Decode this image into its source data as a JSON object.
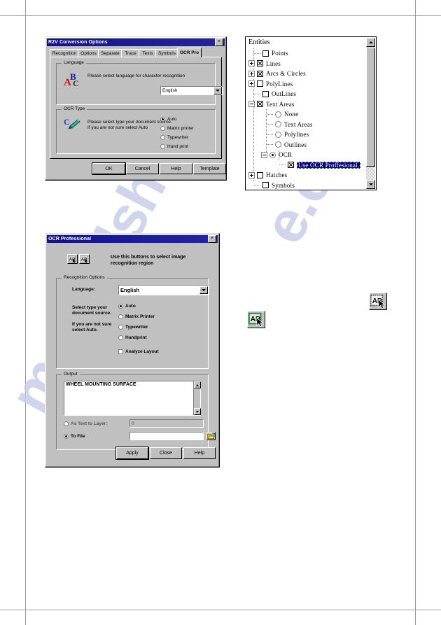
{
  "watermark": {
    "left": "manualshiv",
    "right": "e.com"
  },
  "r2v_dialog": {
    "title": "R2V Conversion Options",
    "close_label": "×",
    "tabs": [
      {
        "label": "Recognition",
        "active": false
      },
      {
        "label": "Options",
        "active": false
      },
      {
        "label": "Separate",
        "active": false
      },
      {
        "label": "Trace",
        "active": false
      },
      {
        "label": "Texts",
        "active": false
      },
      {
        "label": "Symbols",
        "active": false
      },
      {
        "label": "OCR Pro",
        "active": true
      }
    ],
    "language_group": {
      "legend": "Language",
      "icon": "abc-letters-icon",
      "description": "Please select language for character recognition",
      "combo_value": "English"
    },
    "ocr_type_group": {
      "legend": "OCR Type",
      "icon": "pen-writing-icon",
      "description_line1": "Please select type your document source.",
      "description_line2": "If you are not sure select Auto",
      "options": [
        {
          "label": "Auto",
          "mnemonic": "A",
          "selected": true
        },
        {
          "label": "Matrix printer",
          "mnemonic": "M",
          "selected": false
        },
        {
          "label": "Typewriter",
          "mnemonic": "T",
          "selected": false
        },
        {
          "label": "Hand print",
          "mnemonic": "H",
          "selected": false
        }
      ]
    },
    "buttons": [
      {
        "label": "OK",
        "default": true
      },
      {
        "label": "Cancel",
        "default": false
      },
      {
        "label": "Help",
        "default": false
      },
      {
        "label": "Template",
        "default": false
      }
    ]
  },
  "entities_tree": {
    "root_label": "Entities",
    "nodes": [
      {
        "label": "Points",
        "control": "checkbox",
        "checked": false,
        "expander": "none",
        "depth": 1,
        "selected": false
      },
      {
        "label": "Lines",
        "control": "checkbox",
        "checked": true,
        "expander": "plus",
        "depth": 1,
        "selected": false
      },
      {
        "label": "Arcs & Circles",
        "control": "checkbox",
        "checked": true,
        "expander": "plus",
        "depth": 1,
        "selected": false
      },
      {
        "label": "PolyLines",
        "control": "checkbox",
        "checked": false,
        "expander": "plus",
        "depth": 1,
        "selected": false
      },
      {
        "label": "OutLines",
        "control": "checkbox",
        "checked": false,
        "expander": "none",
        "depth": 1,
        "selected": false
      },
      {
        "label": "Text Areas",
        "control": "checkbox",
        "checked": true,
        "expander": "minus",
        "depth": 1,
        "selected": false
      },
      {
        "label": "None",
        "control": "radio",
        "checked": false,
        "expander": "none",
        "depth": 2,
        "selected": false
      },
      {
        "label": "Text Areas",
        "control": "radio",
        "checked": false,
        "expander": "none",
        "depth": 2,
        "selected": false
      },
      {
        "label": "Polylines",
        "control": "radio",
        "checked": false,
        "expander": "none",
        "depth": 2,
        "selected": false
      },
      {
        "label": "Outlines",
        "control": "radio",
        "checked": false,
        "expander": "none",
        "depth": 2,
        "selected": false
      },
      {
        "label": "OCR",
        "control": "radio",
        "checked": true,
        "expander": "minus",
        "depth": 2,
        "selected": false
      },
      {
        "label": "Use OCR Proffesional.",
        "control": "checkbox",
        "checked": true,
        "expander": "none",
        "depth": 3,
        "selected": true
      },
      {
        "label": "Hatches",
        "control": "checkbox",
        "checked": false,
        "expander": "plus",
        "depth": 1,
        "selected": false
      },
      {
        "label": "Symbols",
        "control": "checkbox",
        "checked": false,
        "expander": "none",
        "depth": 1,
        "selected": false
      }
    ],
    "scrollbar": {
      "up_icon": "scroll-up-arrow-icon",
      "down_icon": "scroll-down-arrow-icon"
    }
  },
  "ocr_dialog": {
    "title": "OCR Professional",
    "close_label": "×",
    "toolbar": {
      "button1_icon": "select-region-icon",
      "button2_icon": "select-region-alt-icon",
      "hint_line1": "Use this buttons to select image",
      "hint_line2": "recognition region"
    },
    "recognition_options": {
      "legend": "Recognition Options",
      "language_label": "Language:",
      "language_value": "English",
      "source_label_line1": "Select type your",
      "source_label_line2": "document source.",
      "hint_label_line1": "If you are not sure",
      "hint_label_line2": "select Auto.",
      "options": [
        {
          "label": "Auto",
          "mnemonic": "A",
          "selected": true
        },
        {
          "label": "Matrix Printer",
          "mnemonic": "M",
          "selected": false
        },
        {
          "label": "Typewriter",
          "mnemonic": "T",
          "selected": false
        },
        {
          "label": "Handprint",
          "mnemonic": "H",
          "selected": false
        }
      ],
      "analyze_layout": {
        "label": "Analyze Layout",
        "mnemonic": "A",
        "checked": false
      }
    },
    "output": {
      "legend": "Output",
      "text": "WHEEL MOUNTING SURFACE",
      "as_text_to_layer": {
        "label": "As Text to Layer:",
        "selected": false,
        "value": "0"
      },
      "to_file": {
        "label": "To File",
        "selected": true,
        "value": ""
      },
      "browse_icon": "folder-open-icon"
    },
    "buttons": [
      {
        "label": "Apply",
        "default": true
      },
      {
        "label": "Close",
        "default": false
      },
      {
        "label": "Help",
        "default": false
      }
    ]
  },
  "standalone_icons": [
    {
      "name": "ocr-region-icon-green",
      "letters": "AB"
    },
    {
      "name": "ocr-region-icon-gray",
      "letters": "AB"
    }
  ]
}
